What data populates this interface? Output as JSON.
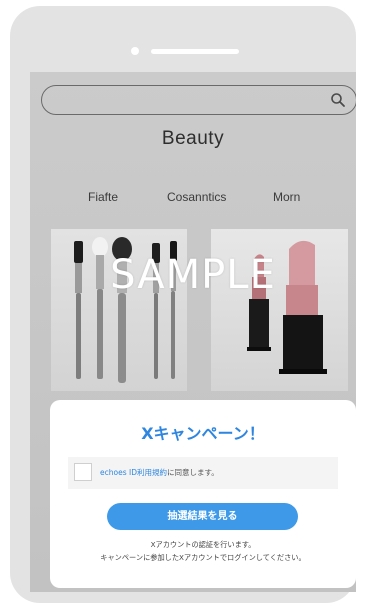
{
  "search": {
    "value": "",
    "placeholder": ""
  },
  "site": {
    "brand": "Beauty",
    "nav": [
      "Fiafte",
      "Cosanntics",
      "Morn"
    ]
  },
  "overlay_text": "SAMPLE",
  "campaign": {
    "title": "Xキャンペーン！",
    "agree_link": "echoes ID利用規約",
    "agree_text": "に同意します。",
    "button_label": "抽選結果を見る",
    "note_1": "Xアカウントの認証を行います。",
    "note_2": "キャンペーンに参加したXアカウントでログインしてください。"
  },
  "colors": {
    "accent": "#2e86e0",
    "button": "#3e9ae8",
    "phone_frame": "#e3e3e3"
  }
}
